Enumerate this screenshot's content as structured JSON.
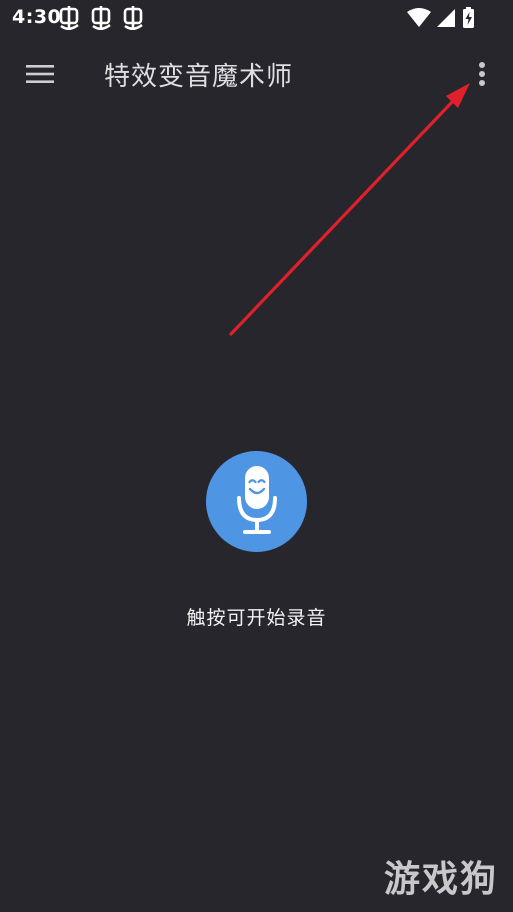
{
  "status_bar": {
    "time": "4:30",
    "notification_icons": [
      "bug-icon",
      "bug-icon",
      "bug-icon"
    ],
    "right_icons": [
      "wifi-icon",
      "signal-icon",
      "battery-charging-icon"
    ]
  },
  "app_bar": {
    "title": "特效变音魔术师",
    "menu_icon": "hamburger-menu-icon",
    "overflow_icon": "more-vert-icon"
  },
  "main": {
    "record_button_icon": "smiling-microphone-icon",
    "hint": "触按可开始录音"
  },
  "annotation": {
    "arrow_color": "#e0202a"
  },
  "watermark": {
    "text": "游戏狗"
  },
  "colors": {
    "background": "#27262c",
    "accent": "#4e95e4"
  }
}
